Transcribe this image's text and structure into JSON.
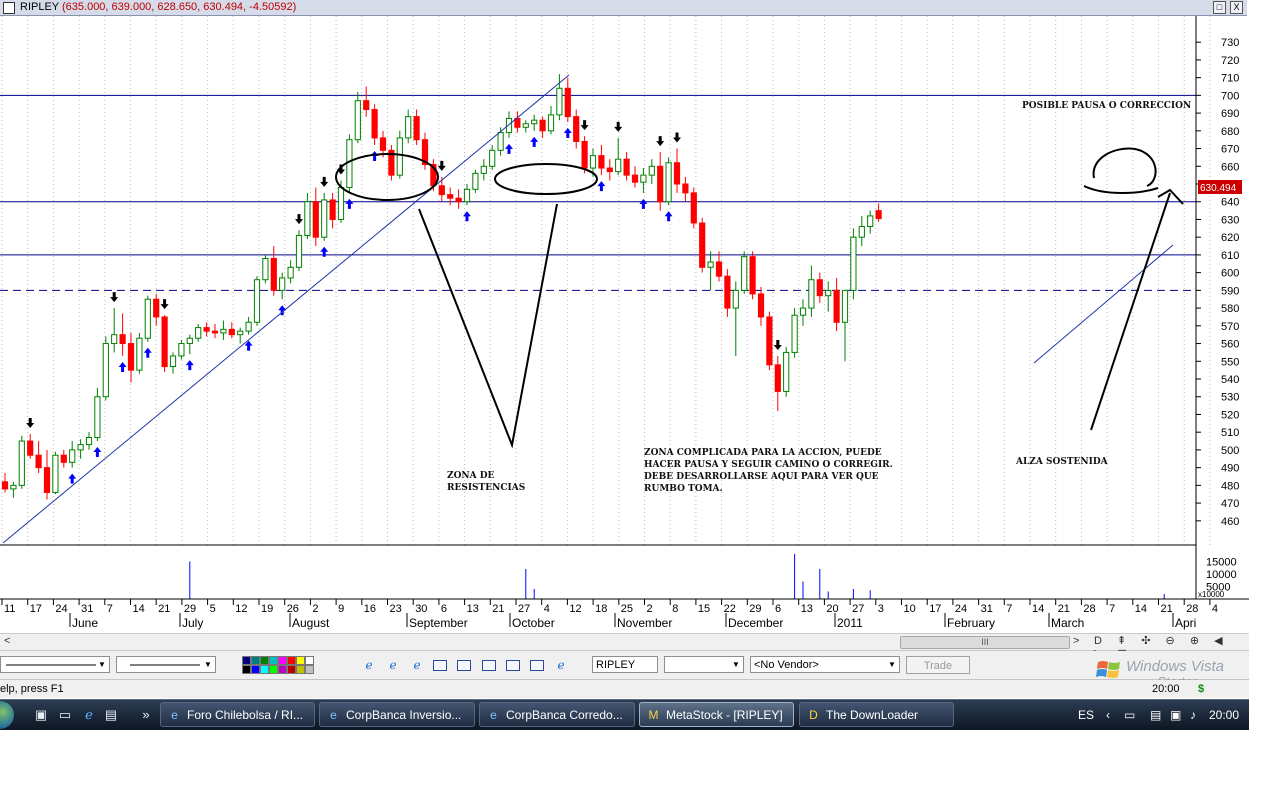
{
  "window": {
    "title": "RIPLEY",
    "values": "(635.000, 639.000, 628.650, 630.494, -4.50592)",
    "restore_glyph": "□",
    "close_glyph": "X"
  },
  "chart_data": {
    "type": "candlestick",
    "symbol": "RIPLEY",
    "price_axis": {
      "ticks": [
        460,
        470,
        480,
        490,
        500,
        510,
        520,
        530,
        540,
        550,
        560,
        570,
        580,
        590,
        600,
        610,
        620,
        630,
        640,
        650,
        660,
        670,
        680,
        690,
        700,
        710,
        720,
        730
      ],
      "ylim": [
        452,
        738
      ],
      "last_price_label": "630.494",
      "last_price": 630.494
    },
    "volume_axis": {
      "ticks": [
        "15000",
        "10000",
        "5000"
      ],
      "multiplier": "x10000"
    },
    "date_ticks": [
      "11",
      "17",
      "24",
      "31",
      "7",
      "14",
      "21",
      "29",
      "5",
      "12",
      "19",
      "26",
      "2",
      "9",
      "16",
      "23",
      "30",
      "6",
      "13",
      "21",
      "27",
      "4",
      "12",
      "18",
      "25",
      "2",
      "8",
      "15",
      "22",
      "29",
      "6",
      "13",
      "20",
      "27",
      "3",
      "10",
      "17",
      "24",
      "31",
      "7",
      "14",
      "21",
      "28",
      "7",
      "14",
      "21",
      "28",
      "4"
    ],
    "month_labels": [
      "June",
      "July",
      "August",
      "September",
      "October",
      "November",
      "December",
      "2011",
      "February",
      "March",
      "Apri"
    ],
    "horizontal_levels": [
      {
        "price": 700,
        "style": "solid"
      },
      {
        "price": 640,
        "style": "solid"
      },
      {
        "price": 610,
        "style": "solid"
      },
      {
        "price": 590,
        "style": "dashed"
      }
    ],
    "colors": {
      "up": "#008000",
      "down": "#ff0000",
      "levels": "#00008b",
      "up_arrow": "#0000ff",
      "down_arrow": "#000000",
      "volume": "#0000ff",
      "price_box": "#cc0000"
    },
    "ohlc": [
      {
        "o": 482,
        "h": 487,
        "l": 476,
        "c": 478
      },
      {
        "o": 478,
        "h": 482,
        "l": 473,
        "c": 480
      },
      {
        "o": 480,
        "h": 508,
        "l": 478,
        "c": 505
      },
      {
        "o": 505,
        "h": 509,
        "l": 495,
        "c": 497
      },
      {
        "o": 497,
        "h": 505,
        "l": 487,
        "c": 490
      },
      {
        "o": 490,
        "h": 500,
        "l": 472,
        "c": 476
      },
      {
        "o": 476,
        "h": 499,
        "l": 475,
        "c": 497
      },
      {
        "o": 497,
        "h": 500,
        "l": 490,
        "c": 493
      },
      {
        "o": 493,
        "h": 505,
        "l": 490,
        "c": 500
      },
      {
        "o": 500,
        "h": 506,
        "l": 495,
        "c": 503
      },
      {
        "o": 503,
        "h": 510,
        "l": 500,
        "c": 507
      },
      {
        "o": 507,
        "h": 535,
        "l": 505,
        "c": 530
      },
      {
        "o": 530,
        "h": 564,
        "l": 528,
        "c": 560
      },
      {
        "o": 560,
        "h": 580,
        "l": 555,
        "c": 565
      },
      {
        "o": 565,
        "h": 577,
        "l": 553,
        "c": 560
      },
      {
        "o": 560,
        "h": 566,
        "l": 538,
        "c": 545
      },
      {
        "o": 545,
        "h": 566,
        "l": 543,
        "c": 563
      },
      {
        "o": 563,
        "h": 587,
        "l": 561,
        "c": 585
      },
      {
        "o": 585,
        "h": 588,
        "l": 570,
        "c": 575
      },
      {
        "o": 575,
        "h": 576,
        "l": 544,
        "c": 547
      },
      {
        "o": 547,
        "h": 555,
        "l": 543,
        "c": 553
      },
      {
        "o": 553,
        "h": 562,
        "l": 551,
        "c": 560
      },
      {
        "o": 560,
        "h": 565,
        "l": 554,
        "c": 563
      },
      {
        "o": 563,
        "h": 571,
        "l": 561,
        "c": 569
      },
      {
        "o": 569,
        "h": 572,
        "l": 564,
        "c": 567
      },
      {
        "o": 567,
        "h": 571,
        "l": 563,
        "c": 566
      },
      {
        "o": 566,
        "h": 573,
        "l": 562,
        "c": 568
      },
      {
        "o": 568,
        "h": 572,
        "l": 563,
        "c": 565
      },
      {
        "o": 565,
        "h": 569,
        "l": 560,
        "c": 567
      },
      {
        "o": 567,
        "h": 575,
        "l": 565,
        "c": 572
      },
      {
        "o": 572,
        "h": 598,
        "l": 570,
        "c": 596
      },
      {
        "o": 596,
        "h": 610,
        "l": 594,
        "c": 608
      },
      {
        "o": 608,
        "h": 615,
        "l": 587,
        "c": 590
      },
      {
        "o": 590,
        "h": 600,
        "l": 585,
        "c": 597
      },
      {
        "o": 597,
        "h": 607,
        "l": 594,
        "c": 603
      },
      {
        "o": 603,
        "h": 624,
        "l": 601,
        "c": 621
      },
      {
        "o": 621,
        "h": 645,
        "l": 619,
        "c": 640
      },
      {
        "o": 640,
        "h": 648,
        "l": 615,
        "c": 620
      },
      {
        "o": 620,
        "h": 645,
        "l": 618,
        "c": 641
      },
      {
        "o": 641,
        "h": 645,
        "l": 625,
        "c": 630
      },
      {
        "o": 630,
        "h": 652,
        "l": 628,
        "c": 648
      },
      {
        "o": 648,
        "h": 678,
        "l": 645,
        "c": 675
      },
      {
        "o": 675,
        "h": 702,
        "l": 673,
        "c": 697
      },
      {
        "o": 697,
        "h": 705,
        "l": 688,
        "c": 692
      },
      {
        "o": 692,
        "h": 695,
        "l": 672,
        "c": 676
      },
      {
        "o": 676,
        "h": 680,
        "l": 665,
        "c": 669
      },
      {
        "o": 669,
        "h": 672,
        "l": 652,
        "c": 655
      },
      {
        "o": 655,
        "h": 680,
        "l": 653,
        "c": 676
      },
      {
        "o": 676,
        "h": 692,
        "l": 673,
        "c": 688
      },
      {
        "o": 688,
        "h": 692,
        "l": 672,
        "c": 675
      },
      {
        "o": 675,
        "h": 679,
        "l": 658,
        "c": 661
      },
      {
        "o": 661,
        "h": 664,
        "l": 646,
        "c": 649
      },
      {
        "o": 649,
        "h": 654,
        "l": 640,
        "c": 644
      },
      {
        "o": 644,
        "h": 648,
        "l": 638,
        "c": 642
      },
      {
        "o": 642,
        "h": 647,
        "l": 636,
        "c": 640
      },
      {
        "o": 640,
        "h": 650,
        "l": 638,
        "c": 647
      },
      {
        "o": 647,
        "h": 658,
        "l": 645,
        "c": 656
      },
      {
        "o": 656,
        "h": 664,
        "l": 652,
        "c": 660
      },
      {
        "o": 660,
        "h": 672,
        "l": 658,
        "c": 669
      },
      {
        "o": 669,
        "h": 682,
        "l": 666,
        "c": 679
      },
      {
        "o": 679,
        "h": 691,
        "l": 676,
        "c": 687
      },
      {
        "o": 687,
        "h": 691,
        "l": 679,
        "c": 682
      },
      {
        "o": 682,
        "h": 686,
        "l": 679,
        "c": 684
      },
      {
        "o": 684,
        "h": 689,
        "l": 680,
        "c": 686
      },
      {
        "o": 686,
        "h": 688,
        "l": 676,
        "c": 680
      },
      {
        "o": 680,
        "h": 694,
        "l": 678,
        "c": 689
      },
      {
        "o": 689,
        "h": 712,
        "l": 686,
        "c": 704
      },
      {
        "o": 704,
        "h": 710,
        "l": 685,
        "c": 688
      },
      {
        "o": 688,
        "h": 692,
        "l": 670,
        "c": 674
      },
      {
        "o": 674,
        "h": 677,
        "l": 656,
        "c": 659
      },
      {
        "o": 659,
        "h": 670,
        "l": 654,
        "c": 666
      },
      {
        "o": 666,
        "h": 672,
        "l": 655,
        "c": 659
      },
      {
        "o": 659,
        "h": 664,
        "l": 652,
        "c": 657
      },
      {
        "o": 657,
        "h": 676,
        "l": 655,
        "c": 664
      },
      {
        "o": 664,
        "h": 668,
        "l": 652,
        "c": 655
      },
      {
        "o": 655,
        "h": 660,
        "l": 648,
        "c": 651
      },
      {
        "o": 651,
        "h": 659,
        "l": 645,
        "c": 655
      },
      {
        "o": 655,
        "h": 664,
        "l": 650,
        "c": 660
      },
      {
        "o": 660,
        "h": 668,
        "l": 635,
        "c": 640
      },
      {
        "o": 640,
        "h": 665,
        "l": 638,
        "c": 662
      },
      {
        "o": 662,
        "h": 670,
        "l": 645,
        "c": 650
      },
      {
        "o": 650,
        "h": 654,
        "l": 640,
        "c": 645
      },
      {
        "o": 645,
        "h": 648,
        "l": 625,
        "c": 628
      },
      {
        "o": 628,
        "h": 631,
        "l": 600,
        "c": 603
      },
      {
        "o": 603,
        "h": 612,
        "l": 590,
        "c": 606
      },
      {
        "o": 606,
        "h": 612,
        "l": 595,
        "c": 598
      },
      {
        "o": 598,
        "h": 602,
        "l": 575,
        "c": 580
      },
      {
        "o": 580,
        "h": 595,
        "l": 553,
        "c": 590
      },
      {
        "o": 590,
        "h": 612,
        "l": 588,
        "c": 609
      },
      {
        "o": 609,
        "h": 612,
        "l": 585,
        "c": 588
      },
      {
        "o": 588,
        "h": 592,
        "l": 570,
        "c": 575
      },
      {
        "o": 575,
        "h": 578,
        "l": 545,
        "c": 548
      },
      {
        "o": 548,
        "h": 553,
        "l": 522,
        "c": 533
      },
      {
        "o": 533,
        "h": 558,
        "l": 530,
        "c": 555
      },
      {
        "o": 555,
        "h": 580,
        "l": 552,
        "c": 576
      },
      {
        "o": 576,
        "h": 585,
        "l": 570,
        "c": 580
      },
      {
        "o": 580,
        "h": 604,
        "l": 575,
        "c": 596
      },
      {
        "o": 596,
        "h": 600,
        "l": 583,
        "c": 587
      },
      {
        "o": 587,
        "h": 595,
        "l": 578,
        "c": 590
      },
      {
        "o": 590,
        "h": 597,
        "l": 567,
        "c": 572
      },
      {
        "o": 572,
        "h": 580,
        "l": 550,
        "c": 590
      },
      {
        "o": 590,
        "h": 625,
        "l": 585,
        "c": 620
      },
      {
        "o": 620,
        "h": 632,
        "l": 615,
        "c": 626
      },
      {
        "o": 626,
        "h": 635,
        "l": 622,
        "c": 632
      },
      {
        "o": 635,
        "h": 639,
        "l": 628.65,
        "c": 630.494
      }
    ],
    "volume": [
      {
        "i": 22,
        "v": 15000
      },
      {
        "i": 62,
        "v": 12000
      },
      {
        "i": 63,
        "v": 4000
      },
      {
        "i": 94,
        "v": 18000
      },
      {
        "i": 95,
        "v": 7000
      },
      {
        "i": 97,
        "v": 12000
      },
      {
        "i": 98,
        "v": 3000
      },
      {
        "i": 101,
        "v": 4000
      },
      {
        "i": 103,
        "v": 3500
      },
      {
        "i": 138,
        "v": 2000
      }
    ],
    "up_arrows": [
      8,
      11,
      14,
      17,
      22,
      29,
      33,
      38,
      41,
      44,
      55,
      60,
      63,
      67,
      71,
      76,
      79,
      133
    ],
    "down_arrows": [
      3,
      13,
      19,
      35,
      38,
      40,
      52,
      69,
      73,
      78,
      80,
      92
    ]
  },
  "annotations": {
    "zona_resistencias": "ZONA DE\nRESISTENCIAS",
    "zona_complicada": "ZONA COMPLICADA PARA LA ACCION, PUEDE\nHACER PAUSA Y SEGUIR CAMINO O CORREGIR.\nDEBE DESARROLLARSE AQUI PARA VER QUE\nRUMBO TOMA.",
    "alza_sostenida": "ALZA SOSTENIDA",
    "posible_pausa": "POSIBLE PAUSA O CORRECCION"
  },
  "scrollbar": {
    "thumb_label": "III",
    "left_arrow": "<",
    "right_arrow": ">",
    "tools": "D ⇞ ✣ ⊖ ⊕ ◀ ▶ ⊞"
  },
  "toolbar": {
    "symbol_value": "RIPLEY",
    "period_value": "",
    "vendor_value": "<No Vendor>",
    "trade_label": "Trade",
    "palette_colors": [
      "#000080",
      "#008080",
      "#008000",
      "#00c0c0",
      "#ff00ff",
      "#ff0000",
      "#ffff00",
      "#ffffff",
      "#000000",
      "#0000ff",
      "#00ffff",
      "#00ff00",
      "#c000c0",
      "#c00000",
      "#c0c000",
      "#c0c0c0"
    ]
  },
  "status": {
    "help_text": "elp, press F1",
    "time": "20:00",
    "dollar": "$"
  },
  "watermark": {
    "line1": "Windows Vista",
    "line2": "Starter"
  },
  "taskbar": {
    "tasks": [
      {
        "label": "Foro Chilebolsa / RI...",
        "icon": "e"
      },
      {
        "label": "CorpBanca Inversio...",
        "icon": "e"
      },
      {
        "label": "CorpBanca Corredo...",
        "icon": "e"
      },
      {
        "label": "MetaStock - [RIPLEY]",
        "icon": "M"
      },
      {
        "label": "The DownLoader",
        "icon": "D"
      }
    ],
    "lang": "ES",
    "clock": "20:00"
  }
}
